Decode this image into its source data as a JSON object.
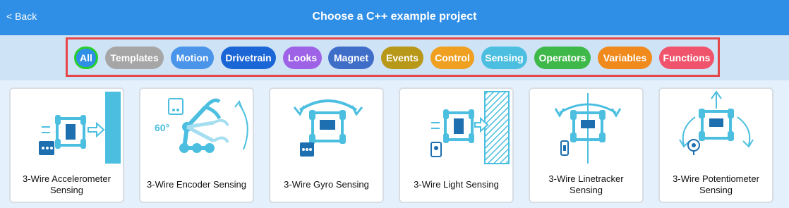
{
  "header": {
    "back_label": "< Back",
    "title": "Choose a C++ example project"
  },
  "filters": [
    {
      "label": "All",
      "color": "#2f8fe6"
    },
    {
      "label": "Templates",
      "color": "#a6a6a6"
    },
    {
      "label": "Motion",
      "color": "#4a94ea"
    },
    {
      "label": "Drivetrain",
      "color": "#1a66d6"
    },
    {
      "label": "Looks",
      "color": "#9e62e6"
    },
    {
      "label": "Magnet",
      "color": "#3f6ec8"
    },
    {
      "label": "Events",
      "color": "#b89818"
    },
    {
      "label": "Control",
      "color": "#f0a020"
    },
    {
      "label": "Sensing",
      "color": "#4cbfe0"
    },
    {
      "label": "Operators",
      "color": "#3fb84a"
    },
    {
      "label": "Variables",
      "color": "#f08a1c"
    },
    {
      "label": "Functions",
      "color": "#f0546c"
    }
  ],
  "projects": [
    {
      "label": "3-Wire Accelerometer Sensing",
      "icon": "accelerometer-icon"
    },
    {
      "label": "3-Wire Encoder Sensing",
      "icon": "encoder-arm-icon",
      "angle_text": "60°"
    },
    {
      "label": "3-Wire Gyro Sensing",
      "icon": "gyro-icon"
    },
    {
      "label": "3-Wire Light Sensing",
      "icon": "light-sensor-icon"
    },
    {
      "label": "3-Wire Linetracker Sensing",
      "icon": "linetracker-icon"
    },
    {
      "label": "3-Wire Potentiometer Sensing",
      "icon": "potentiometer-icon"
    }
  ],
  "colors": {
    "header_bg": "#2f8fe6",
    "filter_band_bg": "#cfe3f7",
    "highlight_border": "#e4464a",
    "icon_blue": "#4cbfe0"
  }
}
